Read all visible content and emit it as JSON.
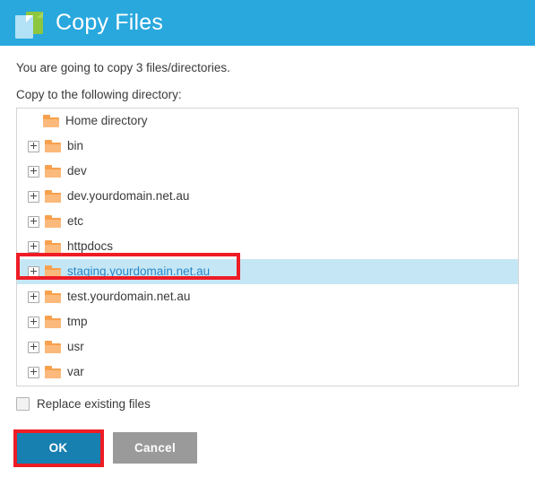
{
  "titlebar": {
    "title": "Copy Files",
    "icon": "copy-files-icon",
    "background": "#29a8de"
  },
  "body": {
    "summary_text": "You are going to copy 3 files/directories.",
    "prompt_text": "Copy to the following directory:"
  },
  "tree": {
    "items": [
      {
        "label": "Home directory",
        "expandable": false,
        "selected": false,
        "icon": "folder-icon"
      },
      {
        "label": "bin",
        "expandable": true,
        "selected": false,
        "icon": "folder-icon"
      },
      {
        "label": "dev",
        "expandable": true,
        "selected": false,
        "icon": "folder-icon"
      },
      {
        "label": "dev.yourdomain.net.au",
        "expandable": true,
        "selected": false,
        "icon": "folder-icon"
      },
      {
        "label": "etc",
        "expandable": true,
        "selected": false,
        "icon": "folder-icon"
      },
      {
        "label": "httpdocs",
        "expandable": true,
        "selected": false,
        "icon": "folder-icon"
      },
      {
        "label": "staging.yourdomain.net.au",
        "expandable": true,
        "selected": true,
        "icon": "folder-icon"
      },
      {
        "label": "test.yourdomain.net.au",
        "expandable": true,
        "selected": false,
        "icon": "folder-icon"
      },
      {
        "label": "tmp",
        "expandable": true,
        "selected": false,
        "icon": "folder-icon"
      },
      {
        "label": "usr",
        "expandable": true,
        "selected": false,
        "icon": "folder-icon"
      },
      {
        "label": "var",
        "expandable": true,
        "selected": false,
        "icon": "folder-icon"
      }
    ],
    "selected_value": "staging.yourdomain.net.au",
    "selection_background": "#c5e7f5",
    "selection_text_color": "#2586c9",
    "expander_glyph": "+"
  },
  "options": {
    "replace_existing_label": "Replace existing files",
    "replace_existing_checked": false
  },
  "buttons": {
    "ok_label": "OK",
    "ok_color": "#1780b0",
    "cancel_label": "Cancel",
    "cancel_color": "#9a9a9a"
  },
  "annotations": {
    "color": "#ee1c25",
    "highlights": [
      "selected-tree-row",
      "ok-button"
    ]
  }
}
